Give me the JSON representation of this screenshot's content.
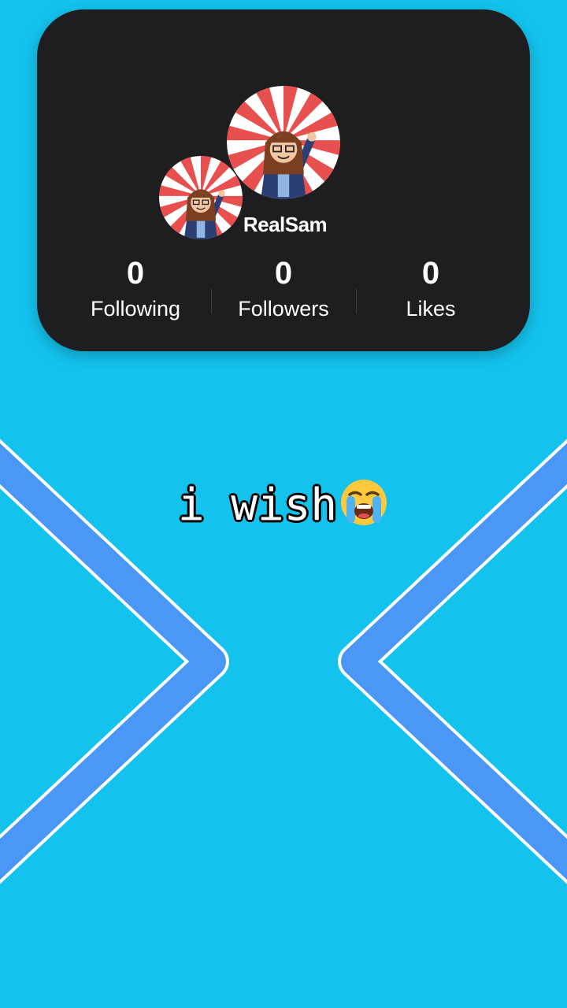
{
  "profile": {
    "username": "RealSam",
    "stats": [
      {
        "value": "0",
        "label": "Following"
      },
      {
        "value": "0",
        "label": "Followers"
      },
      {
        "value": "0",
        "label": "Likes"
      }
    ]
  },
  "caption": {
    "text": "i wish",
    "emoji": "loudly-crying-face-icon"
  },
  "colors": {
    "background": "#13c3ee",
    "card": "#1e1d1f",
    "chevron": "#4a97f5",
    "avatar_ray_red": "#e8504f",
    "avatar_ray_white": "#ffffff"
  }
}
